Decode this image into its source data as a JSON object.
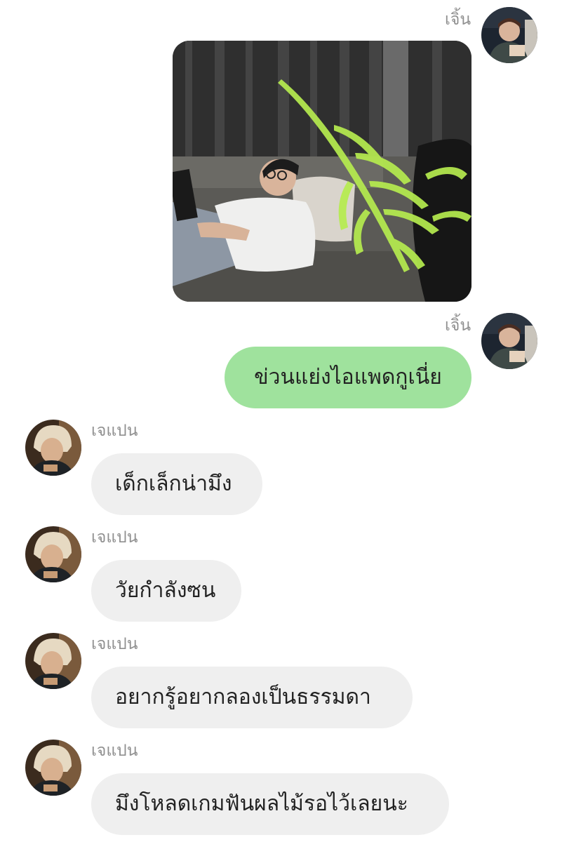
{
  "conversation": {
    "messages": [
      {
        "direction": "outgoing",
        "sender": "เจิ้น",
        "type": "photo"
      },
      {
        "direction": "outgoing",
        "sender": "เจิ้น",
        "type": "text",
        "text": "ข่วนแย่งไอแพดกูเนี่ย"
      },
      {
        "direction": "incoming",
        "sender": "เจแปน",
        "type": "text",
        "text": "เด็กเล็กน่ามึง"
      },
      {
        "direction": "incoming",
        "sender": "เจแปน",
        "type": "text",
        "text": "วัยกำลังซน"
      },
      {
        "direction": "incoming",
        "sender": "เจแปน",
        "type": "text",
        "text": "อยากรู้อยากลองเป็นธรรมดา"
      },
      {
        "direction": "incoming",
        "sender": "เจแปน",
        "type": "text",
        "text": "มึงโหลดเกมฟันผลไม้รอไว้เลยนะ"
      }
    ]
  },
  "colors": {
    "outgoing_bubble": "#9fe29d",
    "incoming_bubble": "#efefef",
    "sender_name": "#8f8f8f",
    "message_text": "#222222",
    "background": "#ffffff"
  }
}
